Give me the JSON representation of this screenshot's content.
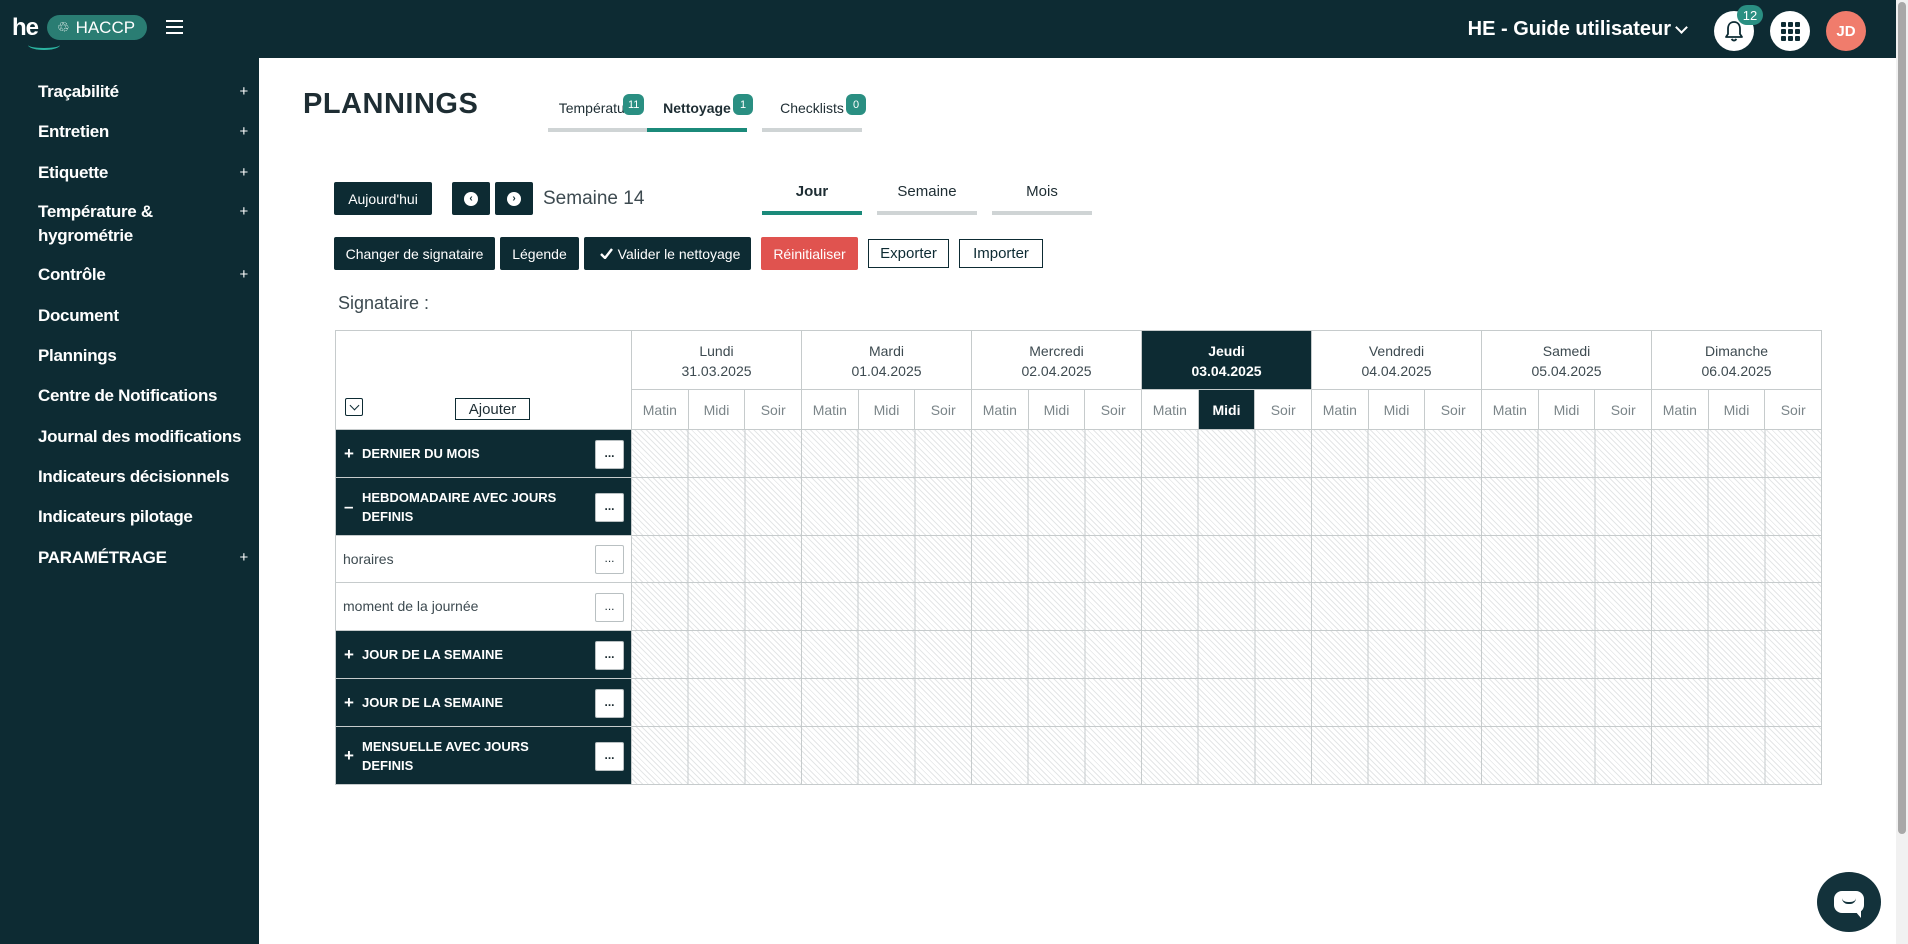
{
  "header": {
    "logo": "he",
    "app_name": "HACCP",
    "workspace": "HE - Guide utilisateur",
    "notification_count": "12",
    "user_initials": "JD"
  },
  "sidebar": {
    "items": [
      {
        "label": "Traçabilité",
        "expandable": "+"
      },
      {
        "label": "Entretien",
        "expandable": "+"
      },
      {
        "label": "Etiquette",
        "expandable": "+"
      },
      {
        "label": "Température & hygrométrie",
        "expandable": "+"
      },
      {
        "label": "Contrôle",
        "expandable": "+"
      },
      {
        "label": "Document"
      },
      {
        "label": "Plannings"
      },
      {
        "label": "Centre de Notifications"
      },
      {
        "label": "Journal des modifications"
      },
      {
        "label": "Indicateurs décisionnels"
      },
      {
        "label": "Indicateurs pilotage"
      },
      {
        "label": "PARAMÉTRAGE",
        "expandable": "+"
      }
    ]
  },
  "page": {
    "title": "PLANNINGS",
    "tabs": [
      {
        "label": "Température",
        "count": "11"
      },
      {
        "label": "Nettoyage",
        "count": "1"
      },
      {
        "label": "Checklists",
        "count": "0"
      }
    ]
  },
  "toolbar": {
    "today": "Aujourd'hui",
    "prev_icon": "chevron-left-icon",
    "next_icon": "chevron-right-icon",
    "week": "Semaine 14",
    "views": [
      "Jour",
      "Semaine",
      "Mois"
    ],
    "change_signer": "Changer de signataire",
    "legend": "Légende",
    "validate": "Valider le nettoyage",
    "validate_icon": "check",
    "reset": "Réinitialiser",
    "export": "Exporter",
    "import": "Importer",
    "signatory_label": "Signataire :"
  },
  "planner": {
    "add_label": "Ajouter",
    "dots": "...",
    "days": [
      {
        "name": "Lundi",
        "date": "31.03.2025"
      },
      {
        "name": "Mardi",
        "date": "01.04.2025"
      },
      {
        "name": "Mercredi",
        "date": "02.04.2025"
      },
      {
        "name": "Jeudi",
        "date": "03.04.2025"
      },
      {
        "name": "Vendredi",
        "date": "04.04.2025"
      },
      {
        "name": "Samedi",
        "date": "05.04.2025"
      },
      {
        "name": "Dimanche",
        "date": "06.04.2025"
      }
    ],
    "slots": [
      "Matin",
      "Midi",
      "Soir"
    ],
    "rows": [
      {
        "label": "DERNIER DU MOIS",
        "kind": "group",
        "toggle": "+"
      },
      {
        "label": "HEBDOMADAIRE AVEC JOURS DEFINIS",
        "kind": "group",
        "toggle": "–"
      },
      {
        "label": "horaires",
        "kind": "sub"
      },
      {
        "label": "moment de la journée",
        "kind": "sub"
      },
      {
        "label": "JOUR DE LA SEMAINE",
        "kind": "group",
        "toggle": "+"
      },
      {
        "label": "JOUR DE LA SEMAINE",
        "kind": "group",
        "toggle": "+"
      },
      {
        "label": "MENSUELLE AVEC JOURS DEFINIS",
        "kind": "group",
        "toggle": "+"
      }
    ]
  },
  "colors": {
    "navy": "#0d2b33",
    "teal": "#2a8f82",
    "red": "#e0534f",
    "avatar": "#f07c6c"
  }
}
